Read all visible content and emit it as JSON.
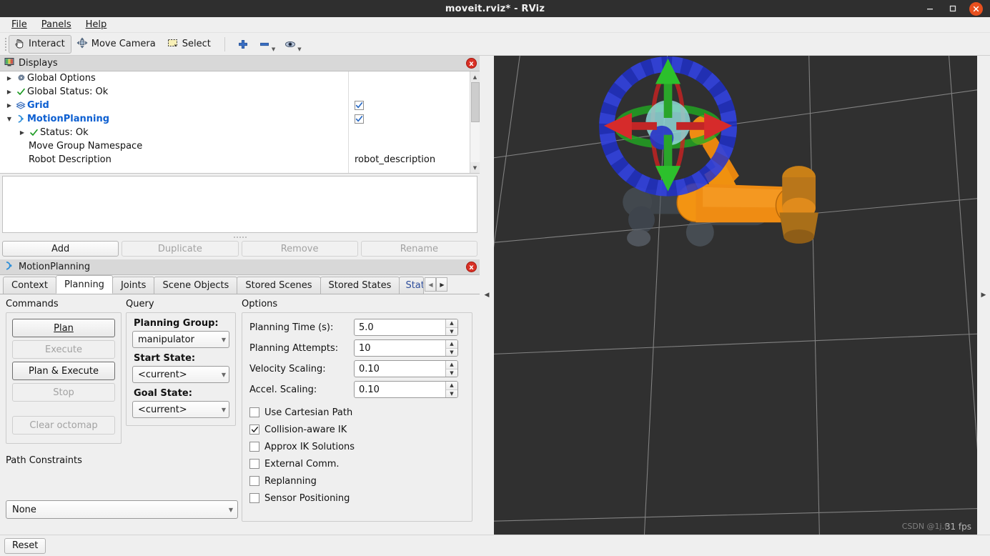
{
  "window": {
    "title": "moveit.rviz* - RViz",
    "minimize_label": "minimize",
    "maximize_label": "maximize",
    "close_label": "close"
  },
  "menubar": {
    "items": [
      {
        "label": "File",
        "accel": "F"
      },
      {
        "label": "Panels",
        "accel": "P"
      },
      {
        "label": "Help",
        "accel": "H"
      }
    ]
  },
  "toolbar": {
    "buttons": [
      {
        "label": "Interact",
        "icon": "hand-cursor-icon",
        "active": true
      },
      {
        "label": "Move Camera",
        "icon": "move-camera-icon",
        "active": false
      },
      {
        "label": "Select",
        "icon": "select-rect-icon",
        "active": false
      }
    ],
    "icon_buttons": [
      {
        "icon": "plus-icon",
        "caret": false
      },
      {
        "icon": "minus-icon",
        "caret": true
      },
      {
        "icon": "focus-eye-icon",
        "caret": true
      }
    ]
  },
  "displays": {
    "title": "Displays",
    "icon": "displays-panel-icon",
    "close_label": "x",
    "tree": [
      {
        "label": "Global Options",
        "icon": "gear-icon",
        "expander": "collapsed",
        "indent": 0,
        "bold": false,
        "checkbox": null,
        "value": ""
      },
      {
        "label": "Global Status: Ok",
        "icon": "check-ok-icon",
        "expander": "collapsed",
        "indent": 0,
        "bold": false,
        "checkbox": null,
        "value": ""
      },
      {
        "label": "Grid",
        "icon": "grid-icon",
        "expander": "collapsed",
        "indent": 0,
        "bold": true,
        "checkbox": true,
        "value": ""
      },
      {
        "label": "MotionPlanning",
        "icon": "motion-planning-icon",
        "expander": "expanded",
        "indent": 0,
        "bold": true,
        "checkbox": true,
        "value": ""
      },
      {
        "label": "Status: Ok",
        "icon": "check-ok-icon",
        "expander": "collapsed",
        "indent": 1,
        "bold": false,
        "checkbox": null,
        "value": ""
      },
      {
        "label": "Move Group Namespace",
        "icon": "none",
        "expander": "none",
        "indent": 1,
        "bold": false,
        "checkbox": null,
        "value": ""
      },
      {
        "label": "Robot Description",
        "icon": "none",
        "expander": "none",
        "indent": 1,
        "bold": false,
        "checkbox": null,
        "value": "robot_description"
      }
    ],
    "buttons": [
      {
        "label": "Add",
        "enabled": true
      },
      {
        "label": "Duplicate",
        "enabled": false
      },
      {
        "label": "Remove",
        "enabled": false
      },
      {
        "label": "Rename",
        "enabled": false
      }
    ]
  },
  "motion_planning": {
    "title": "MotionPlanning",
    "icon": "motion-planning-icon",
    "close_label": "x",
    "tabs": [
      {
        "label": "Context",
        "active": false
      },
      {
        "label": "Planning",
        "active": true
      },
      {
        "label": "Joints",
        "active": false
      },
      {
        "label": "Scene Objects",
        "active": false
      },
      {
        "label": "Stored Scenes",
        "active": false
      },
      {
        "label": "Stored States",
        "active": false
      },
      {
        "label": "Stat",
        "active": false,
        "clipped": true
      }
    ],
    "tab_scroll": {
      "left": "◀",
      "right": "▶"
    },
    "commands": {
      "heading": "Commands",
      "buttons": [
        {
          "label": "Plan",
          "accel": "P",
          "enabled": true,
          "spaced": false
        },
        {
          "label": "Execute",
          "accel": "E",
          "enabled": false,
          "spaced": false
        },
        {
          "label": "Plan & Execute",
          "accel": "x",
          "enabled": true,
          "spaced": false
        },
        {
          "label": "Stop",
          "accel": "S",
          "enabled": false,
          "spaced": false
        },
        {
          "label": "Clear octomap",
          "accel": "",
          "enabled": false,
          "spaced": true
        }
      ]
    },
    "query": {
      "heading": "Query",
      "fields": [
        {
          "label": "Planning Group:",
          "value": "manipulator"
        },
        {
          "label": "Start State:",
          "value": "<current>"
        },
        {
          "label": "Goal State:",
          "value": "<current>"
        }
      ]
    },
    "options": {
      "heading": "Options",
      "spinners": [
        {
          "label": "Planning Time (s):",
          "value": "5.0"
        },
        {
          "label": "Planning Attempts:",
          "value": "10"
        },
        {
          "label": "Velocity Scaling:",
          "value": "0.10"
        },
        {
          "label": "Accel. Scaling:",
          "value": "0.10"
        }
      ],
      "checkboxes": [
        {
          "label": "Use Cartesian Path",
          "checked": false
        },
        {
          "label": "Collision-aware IK",
          "checked": true
        },
        {
          "label": "Approx IK Solutions",
          "checked": false
        },
        {
          "label": "External Comm.",
          "checked": false
        },
        {
          "label": "Replanning",
          "checked": false
        },
        {
          "label": "Sensor Positioning",
          "checked": false
        }
      ]
    },
    "path_constraints": {
      "label": "Path Constraints",
      "value": "None"
    }
  },
  "viewport": {
    "background_color": "#303030",
    "grid_color": "#9a9a9a",
    "robot_color": "#ef8c13",
    "robot_shadow_color": "#4a5560",
    "marker": {
      "ring_color": "#1f2fd0",
      "x_axis_color": "#cc2222",
      "y_axis_color": "#22aa22",
      "z_axis_color": "#2222cc",
      "sphere_color": "#8fd8d8"
    },
    "fps_text": "31 fps",
    "watermark_text": "CSDN @1j.f"
  },
  "splitters": {
    "left_arrow": "◀",
    "right_arrow": "▶"
  },
  "statusbar": {
    "reset_label": "Reset"
  }
}
